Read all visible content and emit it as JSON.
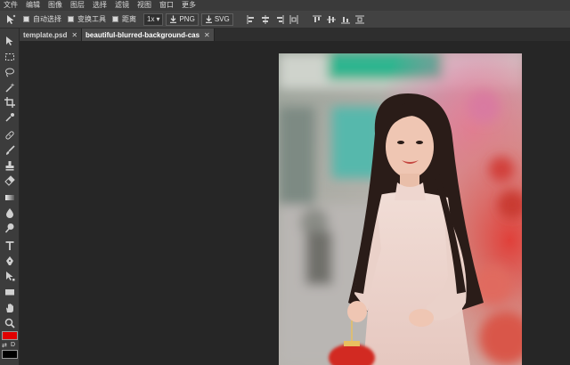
{
  "menu": [
    "文件",
    "编辑",
    "图像",
    "图层",
    "选择",
    "滤镜",
    "视图",
    "窗口",
    "更多"
  ],
  "options": {
    "auto_select": "自动选择",
    "transform_controls": "变换工具",
    "distance": "距离",
    "scale_value": "1x",
    "export_png": "PNG",
    "export_svg": "SVG"
  },
  "tabs": [
    {
      "label": "template.psd",
      "close": "✕"
    },
    {
      "label": "beautiful-blurred-background-cas",
      "close": "✕"
    }
  ],
  "colors": {
    "foreground": "#e00000",
    "background": "#000000",
    "ui_dark": "#262626",
    "ui_panel": "#3c3c3c"
  },
  "tools": [
    "move-tool",
    "marquee-tool",
    "lasso-tool",
    "magic-wand-tool",
    "crop-tool",
    "eyedropper-tool",
    "healing-tool",
    "brush-tool",
    "clone-stamp-tool",
    "eraser-tool",
    "gradient-tool",
    "blur-tool",
    "dodge-tool",
    "type-tool",
    "pen-tool",
    "path-select-tool",
    "shape-tool",
    "hand-tool",
    "zoom-tool"
  ]
}
